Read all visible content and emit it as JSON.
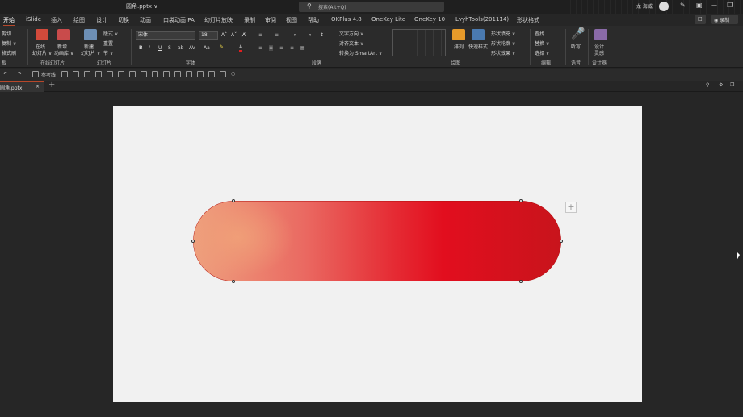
{
  "titlebar": {
    "file_name": "圆角.pptx ∨",
    "search_placeholder": "搜索(Alt+Q)",
    "user_name": "龙 海威"
  },
  "tabs": [
    {
      "label": "开始",
      "active": true
    },
    {
      "label": "iSlide"
    },
    {
      "label": "插入"
    },
    {
      "label": "绘图"
    },
    {
      "label": "设计"
    },
    {
      "label": "切换"
    },
    {
      "label": "动画"
    },
    {
      "label": "口袋动画 PA"
    },
    {
      "label": "幻灯片放映"
    },
    {
      "label": "录制"
    },
    {
      "label": "审阅"
    },
    {
      "label": "视图"
    },
    {
      "label": "帮助"
    },
    {
      "label": "OKPlus 4.8"
    },
    {
      "label": "OneKey Lite"
    },
    {
      "label": "OneKey 10"
    },
    {
      "label": "LvyhTools(201114)"
    },
    {
      "label": "形状格式"
    }
  ],
  "tab_right": {
    "comment_icon": "comment-icon",
    "record_label": "◉ 录制"
  },
  "ribbon": {
    "clipboard": {
      "cut": "剪切",
      "copy": "复制 ∨",
      "format_painter": "格式刷",
      "group": "板"
    },
    "slides": {
      "online": "在线",
      "online2": "幻灯片 ∨",
      "new_anim": "新增",
      "new_anim2": "动画库 ∨",
      "group": "在线幻灯片"
    },
    "newslide": {
      "new": "新建",
      "new2": "幻灯片 ∨",
      "layout": "版式 ∨",
      "reset": "重置",
      "section": "节 ∨",
      "group": "幻灯片"
    },
    "font": {
      "name": "宋体",
      "size": "18",
      "group": "字体",
      "bold": "B",
      "italic": "I",
      "underline": "U",
      "strike": "S",
      "shadow": "ab",
      "spacing": "AV",
      "case": "Aa",
      "clear": "A̸"
    },
    "paragraph": {
      "direction": "文字方向 ∨",
      "align": "对齐文本 ∨",
      "smartart": "转换为 SmartArt ∨",
      "group": "段落"
    },
    "drawing": {
      "arrange": "排列",
      "quick": "快速样式",
      "fill": "形状填充 ∨",
      "outline": "形状轮廓 ∨",
      "effect": "形状效果 ∨",
      "group": "绘图"
    },
    "editing": {
      "find": "查找",
      "replace": "替换 ∨",
      "select": "选择 ∨",
      "group": "编辑"
    },
    "voice": {
      "dictate": "听写",
      "group": "语音"
    },
    "designer": {
      "design": "设计",
      "ideas": "灵感",
      "group": "设计器"
    }
  },
  "qat": {
    "ref_line": "参考线"
  },
  "doc_tab": {
    "name": "圆角.pptx",
    "close": "×",
    "new": "+"
  },
  "slide": {
    "plus": "+"
  },
  "colors": {
    "accent": "#b7472a",
    "pill_left": "#eea07e",
    "pill_mid": "#e20e1e",
    "pill_right": "#c8141c",
    "slide_bg": "#f1f1f1",
    "app_bg": "#262626"
  }
}
